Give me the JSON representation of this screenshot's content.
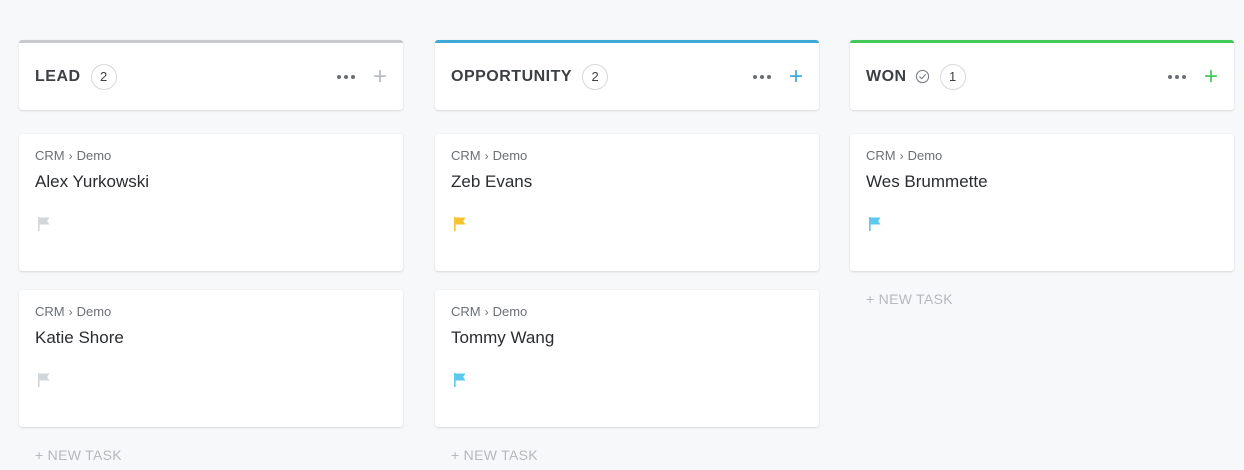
{
  "columns": [
    {
      "title": "LEAD",
      "count": "2",
      "accent": "#c7c9cc",
      "add_color": "#b9bcc0",
      "show_check": false,
      "cards": [
        {
          "path": "CRM",
          "sep": "›",
          "sub": "Demo",
          "name": "Alex Yurkowski",
          "flag_color": "#d3d6d9"
        },
        {
          "path": "CRM",
          "sep": "›",
          "sub": "Demo",
          "name": "Katie Shore",
          "flag_color": "#d3d6d9"
        }
      ],
      "new_task": "+ NEW TASK"
    },
    {
      "title": "OPPORTUNITY",
      "count": "2",
      "accent": "#3fa9d6",
      "add_color": "#3fa9d6",
      "show_check": false,
      "cards": [
        {
          "path": "CRM",
          "sep": "›",
          "sub": "Demo",
          "name": "Zeb Evans",
          "flag_color": "#f4c230"
        },
        {
          "path": "CRM",
          "sep": "›",
          "sub": "Demo",
          "name": "Tommy Wang",
          "flag_color": "#5bc8ee"
        }
      ],
      "new_task": "+ NEW TASK"
    },
    {
      "title": "WON",
      "count": "1",
      "accent": "#41c95a",
      "add_color": "#41c95a",
      "show_check": true,
      "cards": [
        {
          "path": "CRM",
          "sep": "›",
          "sub": "Demo",
          "name": "Wes Brummette",
          "flag_color": "#5bc8ee"
        }
      ],
      "new_task": "+ NEW TASK"
    }
  ],
  "icons": {
    "more": "more-dots-icon",
    "add": "plus-icon",
    "flag": "flag-icon",
    "check": "check-circle-icon"
  },
  "add_glyph": "+"
}
